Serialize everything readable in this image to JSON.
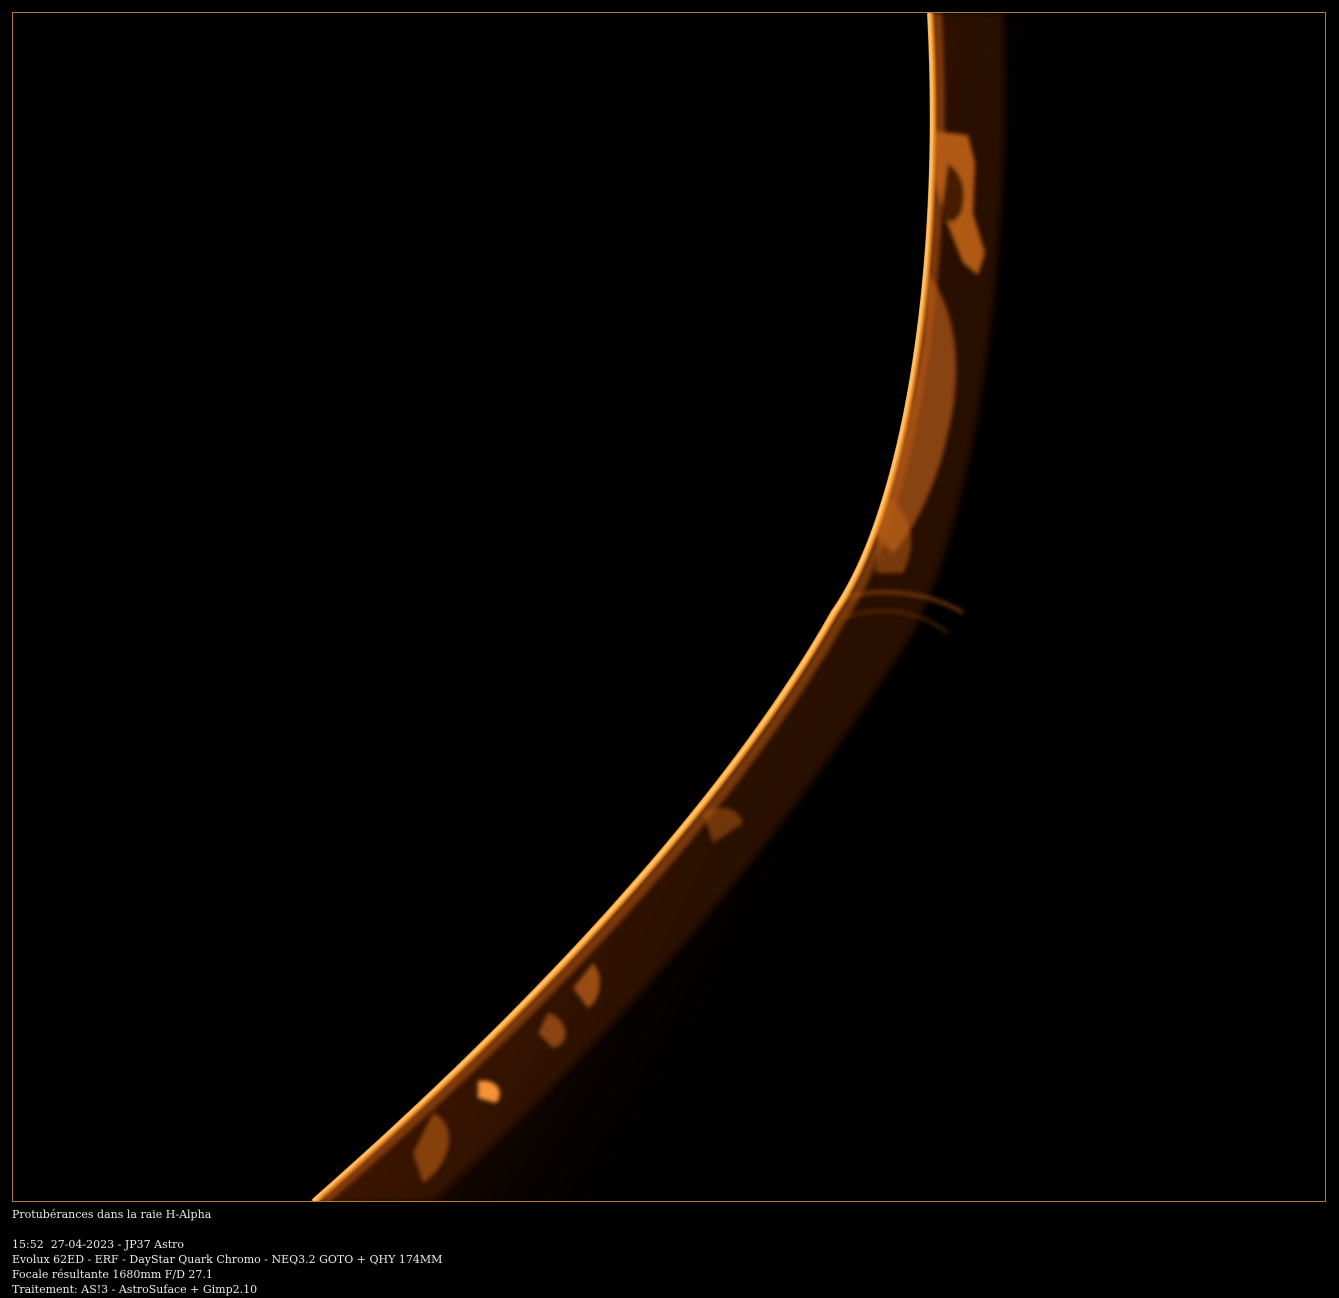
{
  "image": {
    "subject": "solar-limb-h-alpha-prominences",
    "colors": {
      "background": "#000000",
      "frame": "#b07a3a",
      "limb_bright": "#ffb347",
      "chromosphere": "#e07a10",
      "prominence": "#d2721a",
      "glow_dark": "#3a1400",
      "caption_text": "#e8e8e8"
    }
  },
  "caption": {
    "title": "Protubérances dans la raie H-Alpha",
    "datetime_author": "15:52  27-04-2023 - JP37 Astro",
    "equipment": "Evolux 62ED - ERF - DayStar Quark Chromo - NEQ3.2 GOTO + QHY 174MM",
    "focal": "Focale résultante 1680mm F/D 27.1",
    "processing": "Traitement: AS!3 - AstroSuface + Gimp2.10"
  }
}
